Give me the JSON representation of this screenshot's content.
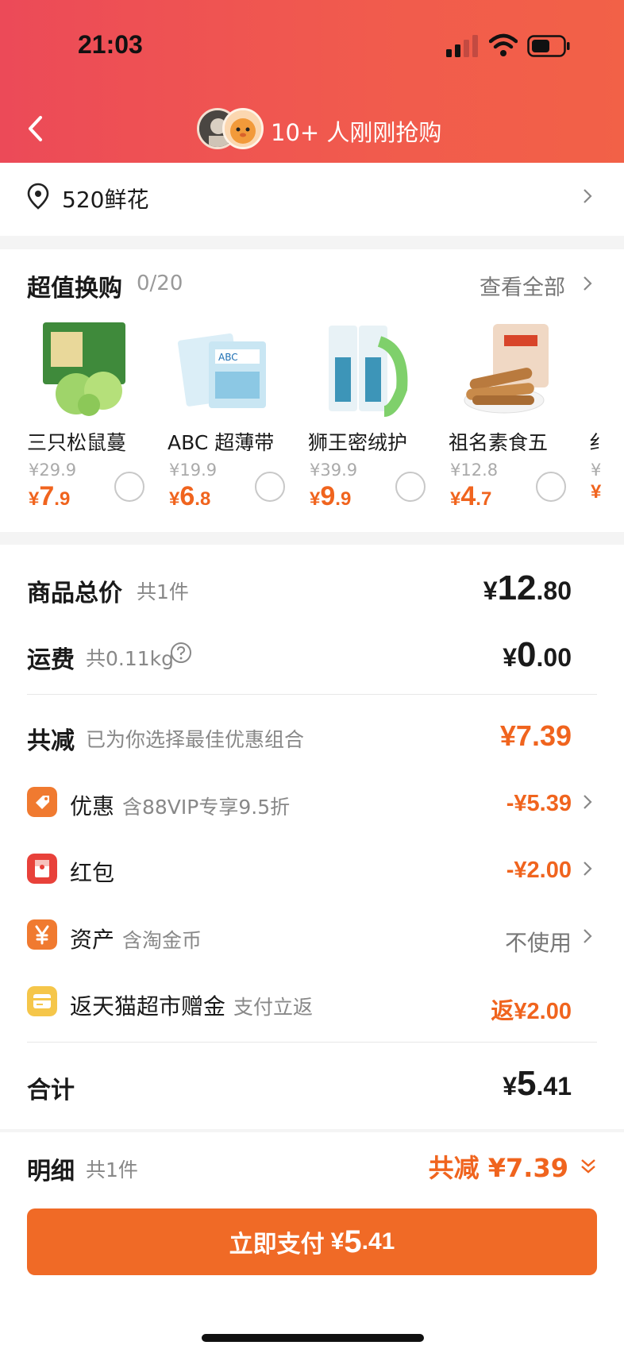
{
  "status_bar": {
    "time": "21:03"
  },
  "header": {
    "buyers_text": "10+ 人刚刚抢购"
  },
  "address": {
    "label": "520鲜花"
  },
  "swap": {
    "title": "超值换购",
    "count": "0/20",
    "view_all": "查看全部",
    "products": [
      {
        "name": "三只松鼠蔓",
        "orig_price": "¥29.9",
        "currency": "¥",
        "price_int": "7",
        "price_dec": ".9"
      },
      {
        "name": "ABC 超薄带",
        "orig_price": "¥19.9",
        "currency": "¥",
        "price_int": "6",
        "price_dec": ".8"
      },
      {
        "name": "狮王密绒护",
        "orig_price": "¥39.9",
        "currency": "¥",
        "price_int": "9",
        "price_dec": ".9"
      },
      {
        "name": "祖名素食五",
        "orig_price": "¥12.8",
        "currency": "¥",
        "price_int": "4",
        "price_dec": ".7"
      },
      {
        "name": "纟",
        "orig_price": "¥",
        "currency": "¥",
        "price_int": "",
        "price_dec": ""
      }
    ]
  },
  "summary": {
    "goods_total_label": "商品总价",
    "goods_total_sub": "共1件",
    "goods_total_cur": "¥",
    "goods_total_int": "12",
    "goods_total_dec": ".80",
    "shipping_label": "运费",
    "shipping_sub": "共0.11kg",
    "shipping_cur": "¥",
    "shipping_int": "0",
    "shipping_dec": ".00",
    "reduce_label": "共减",
    "reduce_sub": "已为你选择最佳优惠组合",
    "reduce_amount": "¥7.39",
    "discounts": [
      {
        "label": "优惠",
        "sub": "含88VIP专享9.5折",
        "amount": "-¥5.39"
      },
      {
        "label": "红包",
        "sub": "",
        "amount": "-¥2.00"
      },
      {
        "label": "资产",
        "sub": "含淘金币",
        "amount": "不使用"
      },
      {
        "label": "返天猫超市赠金",
        "sub": "支付立返",
        "amount": "返¥2.00"
      }
    ],
    "total_label": "合计",
    "total_cur": "¥",
    "total_int": "5",
    "total_dec": ".41"
  },
  "bottom": {
    "detail_label": "明细",
    "detail_sub": "共1件",
    "detail_total": "共减 ¥7.39",
    "pay_label": "立即支付",
    "pay_cur": "¥",
    "pay_int": "5",
    "pay_dec": ".41"
  },
  "colors": {
    "header_gradient_start": "#ec4a58",
    "header_gradient_end": "#f26147",
    "accent_orange": "#f0641e",
    "pay_button": "#f06a26"
  },
  "icons": [
    "signal-icon",
    "wifi-icon",
    "battery-icon",
    "back-arrow-icon",
    "location-pin-icon",
    "chevron-right-icon",
    "help-circle-icon",
    "discount-tag-icon",
    "red-packet-icon",
    "yen-asset-icon",
    "gift-card-icon",
    "double-chevron-down-icon"
  ]
}
